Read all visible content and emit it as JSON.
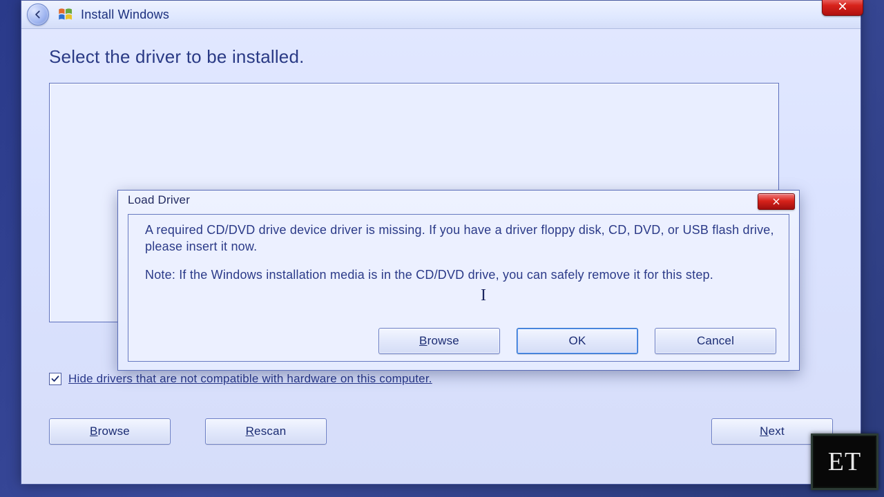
{
  "mainWindow": {
    "title": "Install Windows",
    "heading": "Select the driver to be installed.",
    "hideCheckbox": {
      "checked": true,
      "label": "Hide drivers that are not compatible with hardware on this computer."
    },
    "buttons": {
      "browse_prefix": "B",
      "browse_rest": "rowse",
      "rescan_prefix": "R",
      "rescan_rest": "escan",
      "next_prefix": "N",
      "next_rest": "ext"
    }
  },
  "loadDriver": {
    "title": "Load Driver",
    "msg1": "A required CD/DVD drive device driver is missing. If you have a driver floppy disk, CD, DVD, or USB flash drive, please insert it now.",
    "msg2": "Note: If the Windows installation media is in the CD/DVD drive, you can safely remove it for this step.",
    "buttons": {
      "browse_prefix": "B",
      "browse_rest": "rowse",
      "ok": "OK",
      "cancel": "Cancel"
    }
  },
  "stamp": "ET"
}
